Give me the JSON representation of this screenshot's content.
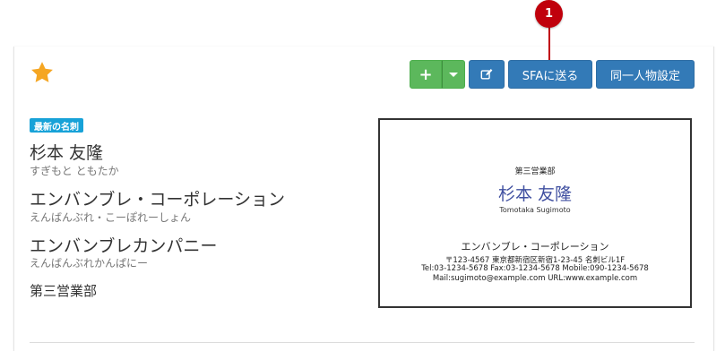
{
  "callout": {
    "number": "1"
  },
  "toolbar": {
    "add_label": "+",
    "sfa_label": "SFAに送る",
    "same_person_label": "同一人物設定"
  },
  "colors": {
    "star": "#f5a623",
    "button_green": "#5cb85c",
    "button_blue": "#337ab7",
    "badge": "#17a2d8",
    "callout": "#c0000c",
    "card_name": "#3f4fa0"
  },
  "contact": {
    "badge": "最新の名刺",
    "name": "杉本 友隆",
    "name_kana": "すぎもと ともたか",
    "company": "エンバンブレ・コーポレーション",
    "company_kana": "えんばんぶれ・こーぽれーしょん",
    "company_alt": "エンバンブレカンパニー",
    "company_alt_kana": "えんばんぶれかんぱにー",
    "department": "第三営業部"
  },
  "business_card": {
    "department": "第三営業部",
    "name": "杉本 友隆",
    "name_roman": "Tomotaka  Sugimoto",
    "company": "エンバンブレ・コーポレーション",
    "address": "〒123-4567 東京都新宿区新宿1-23-45 名刺ビル1F",
    "tel_line": "Tel:03-1234-5678   Fax:03-1234-5678   Mobile:090-1234-5678",
    "mail_line": "Mail:sugimoto@example.com    URL:www.example.com"
  }
}
